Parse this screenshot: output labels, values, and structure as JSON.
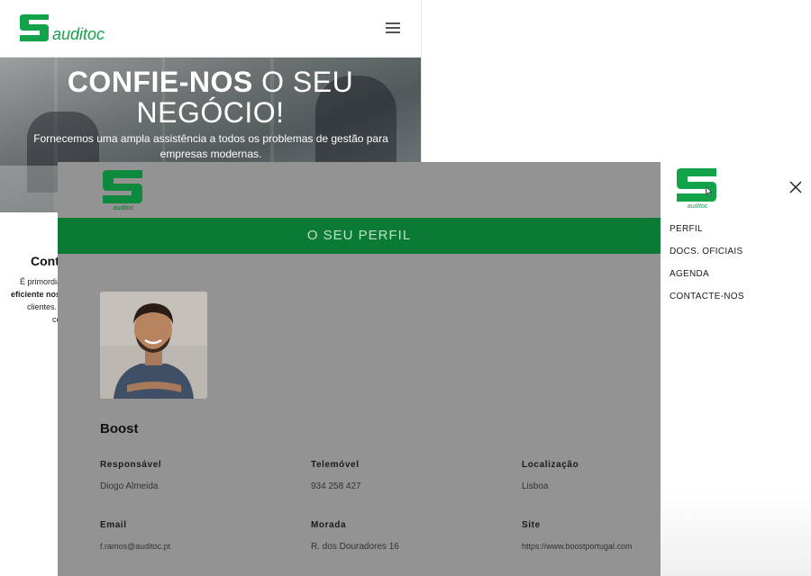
{
  "header": {
    "logo_text": "auditoc"
  },
  "hero": {
    "title_bold": "CONFIE-NOS",
    "title_light": "O SEU",
    "title_line2": "NEGÓCIO!",
    "subtitle": "Fornecemos uma ampla assistência a todos os problemas de gestão para empresas modernas."
  },
  "contact_snippet": {
    "heading": "Cont",
    "lines": [
      "É primordia",
      "eficiente nos r",
      "clientes.",
      "co"
    ]
  },
  "profile": {
    "logo_text": "auditoc",
    "bar_title": "O SEU PERFIL",
    "company": "Boost",
    "fields": {
      "responsavel": {
        "label": "Responsável",
        "value": "Diogo Almeida"
      },
      "telemovel": {
        "label": "Telemóvel",
        "value": "934 258 427"
      },
      "localizacao": {
        "label": "Localização",
        "value": "Lisboa"
      },
      "email": {
        "label": "Email",
        "value": "f.ramos@auditoc.pt"
      },
      "morada": {
        "label": "Morada",
        "value": "R. dos Douradores 16"
      },
      "site": {
        "label": "Site",
        "value": "https://www.boostportugal.com"
      }
    }
  },
  "side_nav": {
    "logo_text": "auditoc",
    "items": [
      "PERFIL",
      "DOCS. OFICIAIS",
      "AGENDA",
      "CONTACTE-NOS"
    ],
    "icons": {
      "close": "close-icon",
      "menu": "hamburger-menu-icon"
    }
  },
  "colors": {
    "brand_green": "#0a7a35",
    "logo_green": "#12a24a",
    "overlay_grey": "#939393"
  }
}
